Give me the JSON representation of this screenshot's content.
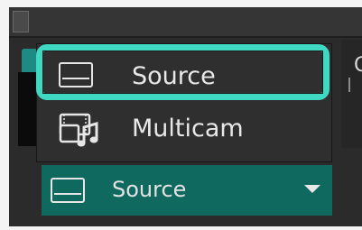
{
  "menu": {
    "items": [
      {
        "label": "Source",
        "icon": "source-icon",
        "selected": true
      },
      {
        "label": "Multicam",
        "icon": "multicam-icon",
        "selected": false
      }
    ]
  },
  "selector": {
    "label": "Source",
    "icon": "source-icon",
    "dropdown_icon": "chevron-down-icon"
  },
  "partial_text": {
    "right_edge_char": "C"
  },
  "colors": {
    "highlight": "#3ed8c3",
    "selector_bg": "#10695f",
    "panel_bg": "#2b2b2b",
    "text": "#e8e8e8"
  }
}
